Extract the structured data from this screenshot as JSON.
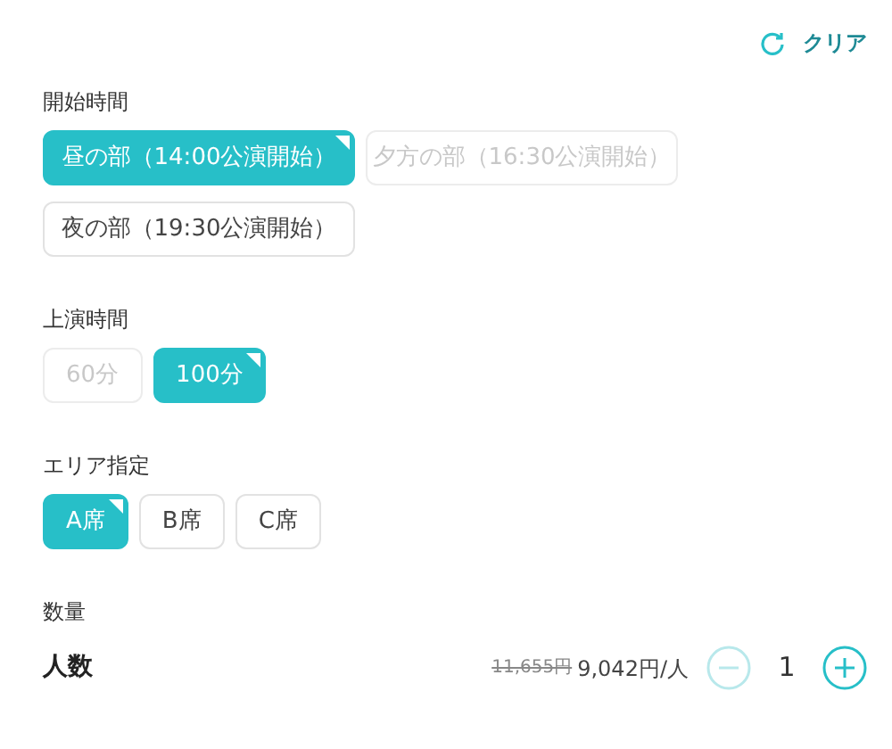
{
  "clear_button": {
    "label": "クリア"
  },
  "sections": [
    {
      "title": "開始時間",
      "options": [
        {
          "label": "昼の部（14:00公演開始）",
          "selected": true,
          "disabled": false
        },
        {
          "label": "夕方の部（16:30公演開始）",
          "selected": false,
          "disabled": true
        },
        {
          "label": "夜の部（19:30公演開始）",
          "selected": false,
          "disabled": false
        }
      ]
    },
    {
      "title": "上演時間",
      "options": [
        {
          "label": "60分",
          "selected": false,
          "disabled": true
        },
        {
          "label": "100分",
          "selected": true,
          "disabled": false
        }
      ]
    },
    {
      "title": "エリア指定",
      "options": [
        {
          "label": "A席",
          "selected": true,
          "disabled": false
        },
        {
          "label": "B席",
          "selected": false,
          "disabled": false
        },
        {
          "label": "C席",
          "selected": false,
          "disabled": false
        }
      ]
    }
  ],
  "quantity": {
    "title": "数量",
    "label": "人数",
    "original_price": "11,655円",
    "price": "9,042円/人",
    "count": "1",
    "decrease_disabled": true,
    "increase_disabled": false
  }
}
